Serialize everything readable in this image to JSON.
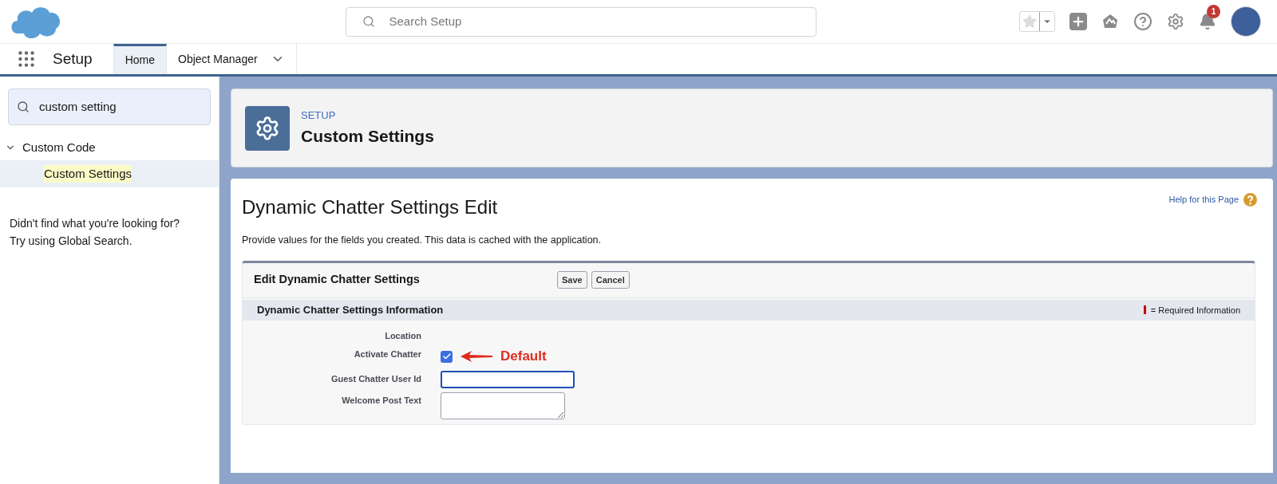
{
  "header": {
    "search": {
      "placeholder": "Search Setup"
    },
    "notifications": {
      "count": "1"
    }
  },
  "nav": {
    "app_name": "Setup",
    "tabs": [
      {
        "label": "Home",
        "selected": true,
        "dropdown": false
      },
      {
        "label": "Object Manager",
        "selected": false,
        "dropdown": true
      }
    ]
  },
  "sidebar": {
    "search": {
      "value": "custom setting"
    },
    "tree": [
      {
        "label": "Custom Code",
        "expanded": true,
        "children": [
          {
            "label": "Custom Settings",
            "highlighted": true,
            "selected": true
          }
        ]
      }
    ],
    "hint": [
      "Didn't find what you're looking for?",
      "Try using Global Search."
    ]
  },
  "page_header": {
    "eyebrow": "SETUP",
    "title": "Custom Settings"
  },
  "main": {
    "title": "Dynamic Chatter Settings Edit",
    "help_link": "Help for this Page",
    "description": "Provide values for the fields you created. This data is cached with the application.",
    "form": {
      "title": "Edit Dynamic Chatter Settings",
      "buttons": [
        "Save",
        "Cancel"
      ],
      "section_title": "Dynamic Chatter Settings Information",
      "required_legend": "= Required Information",
      "fields": [
        {
          "kind": "label",
          "label": "Location"
        },
        {
          "kind": "checkbox",
          "label": "Activate Chatter",
          "checked": true,
          "annotation": "Default"
        },
        {
          "kind": "input",
          "label": "Guest Chatter User Id",
          "focused": true
        },
        {
          "kind": "textarea",
          "label": "Welcome Post Text"
        }
      ]
    }
  }
}
